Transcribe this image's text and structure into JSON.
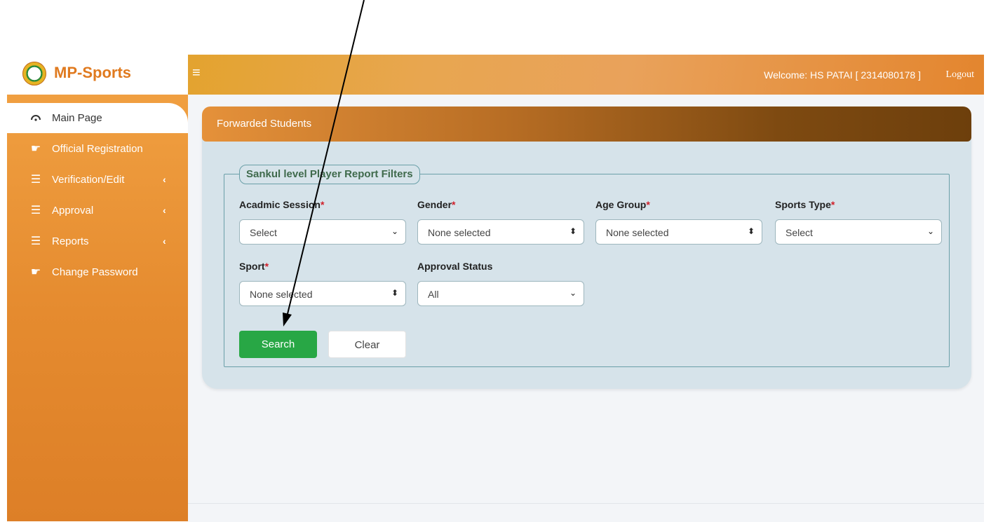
{
  "brand": {
    "name": "MP-Sports",
    "logo_icon": "mp-sports-logo"
  },
  "sidebar": {
    "items": [
      {
        "label": "Main Page",
        "icon": "dashboard-gauge-icon",
        "active": true,
        "has_submenu": false
      },
      {
        "label": "Official Registration",
        "icon": "pointing-hand-icon",
        "active": false,
        "has_submenu": false
      },
      {
        "label": "Verification/Edit",
        "icon": "list-icon",
        "active": false,
        "has_submenu": true
      },
      {
        "label": "Approval",
        "icon": "list-icon",
        "active": false,
        "has_submenu": true
      },
      {
        "label": "Reports",
        "icon": "list-icon",
        "active": false,
        "has_submenu": true
      },
      {
        "label": "Change Password",
        "icon": "pointing-hand-icon",
        "active": false,
        "has_submenu": false
      }
    ],
    "submenu_arrow": "‹"
  },
  "topbar": {
    "menu_icon": "≡",
    "welcome": "Welcome: HS PATAI [ 2314080178 ]",
    "logout": "Logout"
  },
  "panel": {
    "title": "Forwarded Students",
    "filters": {
      "legend": "Sankul level Player Report Filters",
      "required_mark": "*",
      "fields": {
        "session": {
          "label": "Acadmic Session",
          "value": "Select",
          "required": true
        },
        "gender": {
          "label": "Gender",
          "value": "None selected",
          "required": true
        },
        "age_group": {
          "label": "Age Group",
          "value": "None selected",
          "required": true
        },
        "sports_type": {
          "label": "Sports Type",
          "value": "Select",
          "required": true
        },
        "sport": {
          "label": "Sport",
          "value": "None selected",
          "required": true
        },
        "approval_status": {
          "label": "Approval Status",
          "value": "All",
          "required": false
        }
      },
      "buttons": {
        "search": "Search",
        "clear": "Clear"
      }
    }
  },
  "colors": {
    "sidebar": "#e58b2f",
    "brand_text": "#e07a1f",
    "panel_bg": "#d6e3ea",
    "search_button": "#28a745",
    "required": "#d0202a"
  }
}
